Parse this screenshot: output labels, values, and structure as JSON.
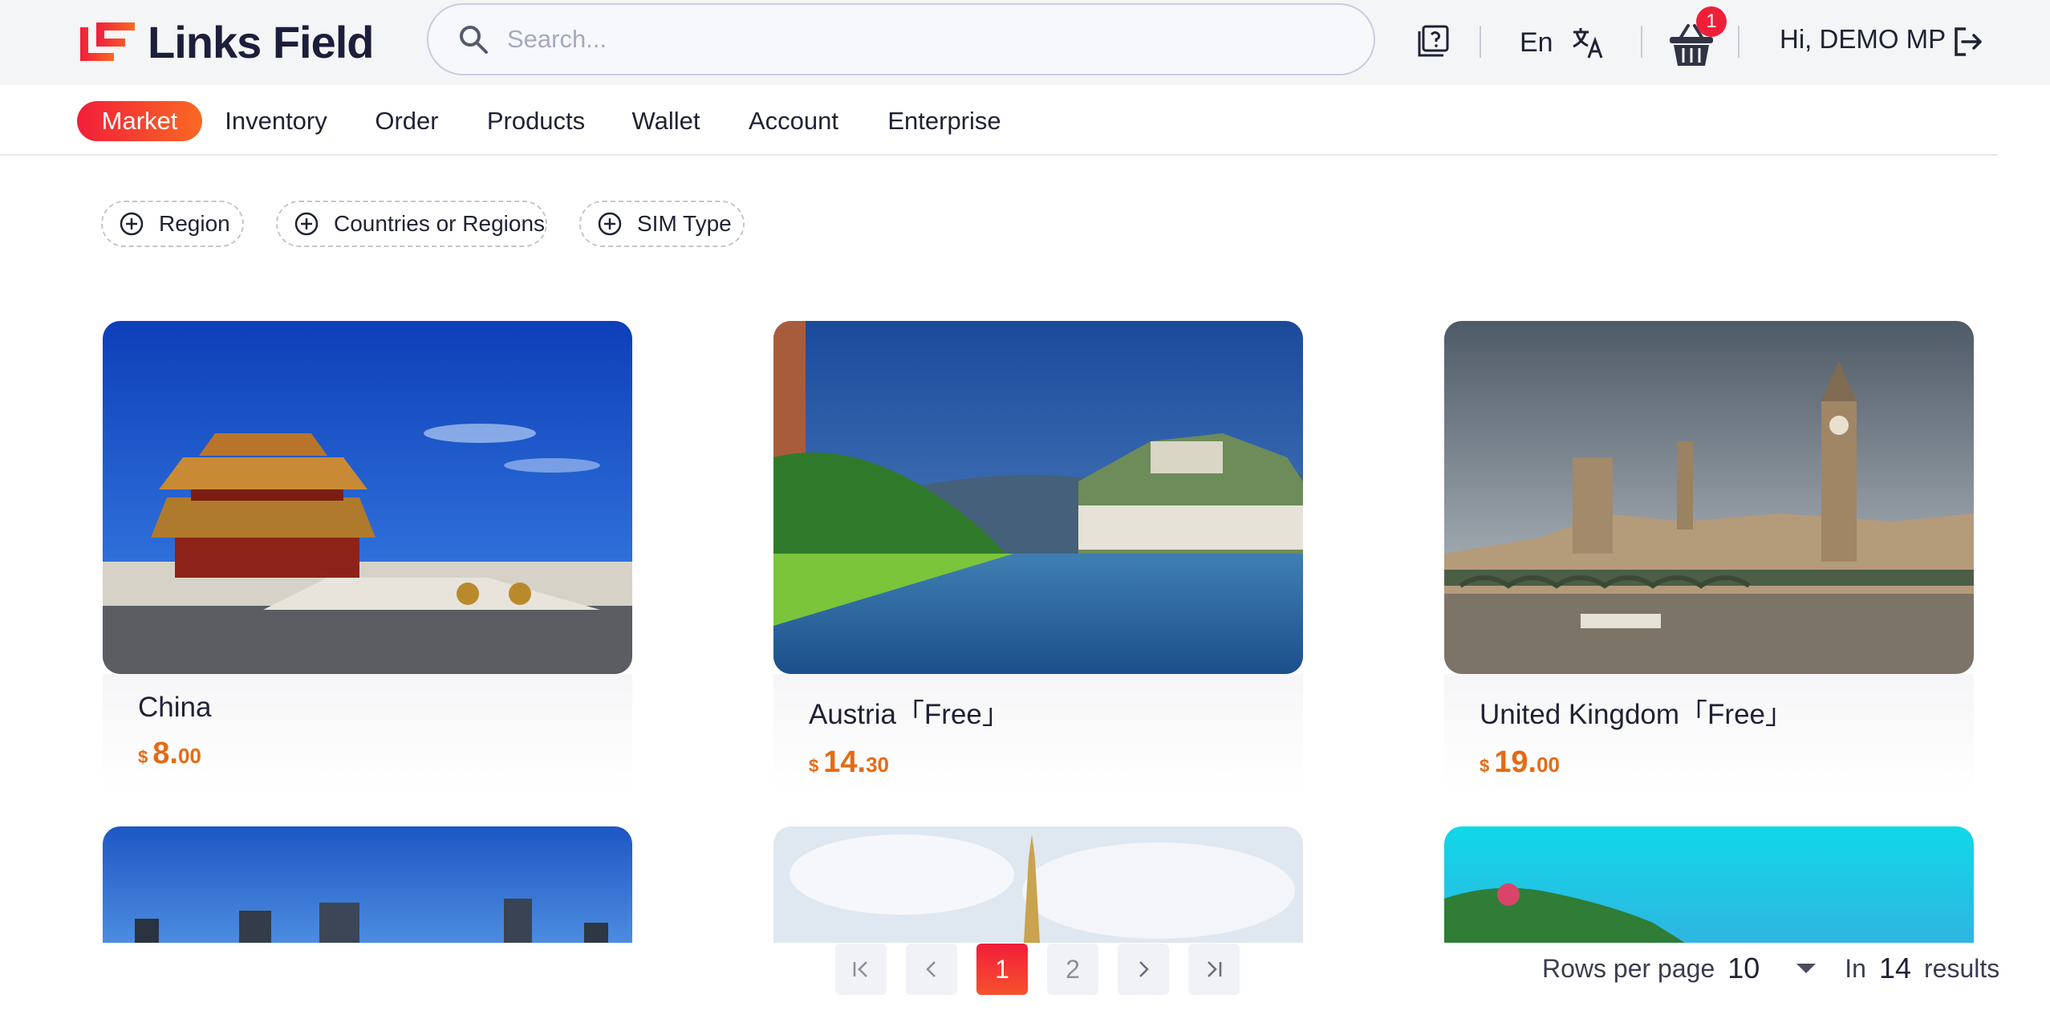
{
  "brand": {
    "name": "Links Field"
  },
  "search": {
    "placeholder": "Search..."
  },
  "header": {
    "language": "En",
    "cart_count": "1",
    "greeting": "Hi, DEMO MP"
  },
  "nav": {
    "items": [
      {
        "label": "Market",
        "active": true
      },
      {
        "label": "Inventory"
      },
      {
        "label": "Order"
      },
      {
        "label": "Products"
      },
      {
        "label": "Wallet"
      },
      {
        "label": "Account"
      },
      {
        "label": "Enterprise"
      }
    ]
  },
  "filters": [
    "Region",
    "Countries or Regions",
    "SIM Type"
  ],
  "products": [
    {
      "name": "China",
      "currency": "$",
      "price_int": "8.",
      "price_dec": "00"
    },
    {
      "name": "Austria「Free」",
      "currency": "$",
      "price_int": "14.",
      "price_dec": "30"
    },
    {
      "name": "United Kingdom「Free」",
      "currency": "$",
      "price_int": "19.",
      "price_dec": "00"
    }
  ],
  "pagination": {
    "pages": [
      "1",
      "2"
    ],
    "current": "1",
    "rows_label": "Rows per page",
    "rows_value": "10",
    "in_label": "In",
    "total": "14",
    "results_label": "results"
  },
  "colors": {
    "accent": "#f21d3a",
    "accent2": "#f96a23",
    "price": "#e66a13"
  }
}
